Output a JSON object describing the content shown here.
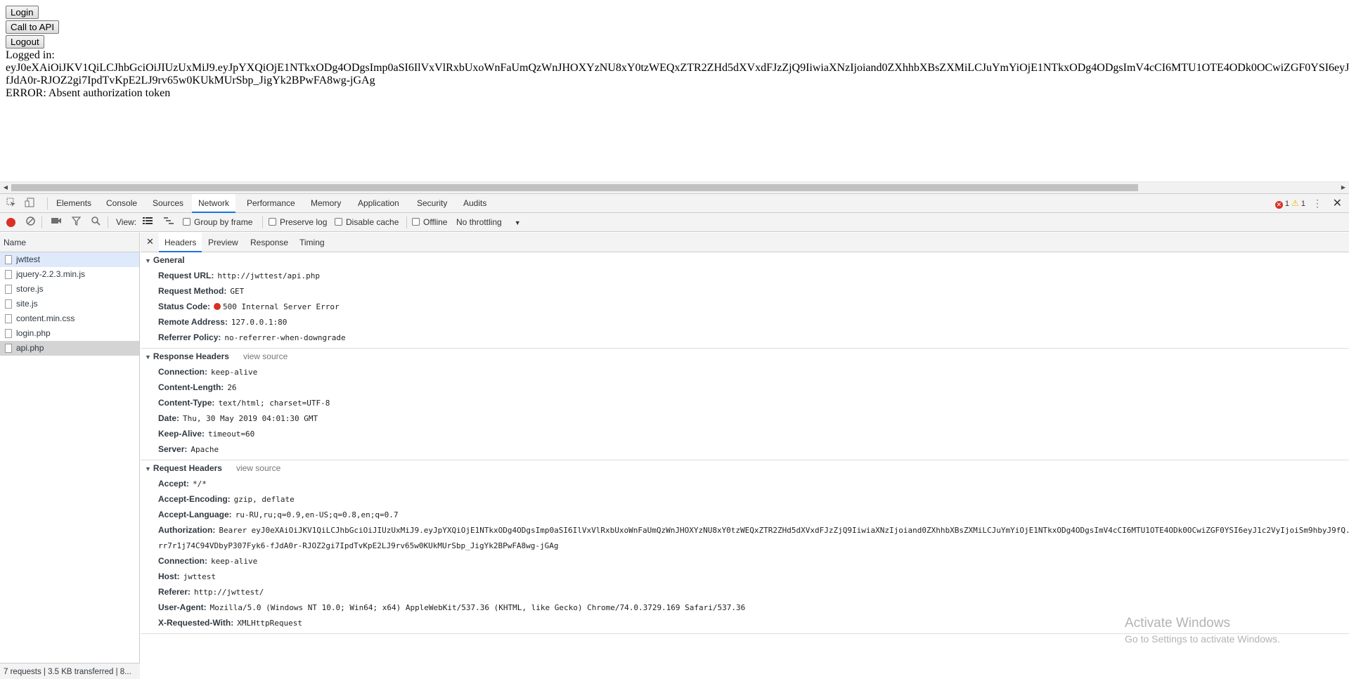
{
  "page": {
    "login_label": "Login",
    "call_api_label": "Call to API",
    "logout_label": "Logout",
    "logged_in_label": "Logged in:",
    "token_line1": "eyJ0eXAiOiJKV1QiLCJhbGciOiJIUzUxMiJ9.eyJpYXQiOjE1NTkxODg4ODgsImp0aSI6IlVxVlRxbUxoWnFaUmQzWnJHOXYzNU8xY0tzWEQxZTR2ZHd5dXVxdFJzZjQ9IiwiaXNzIjoiand0ZXhhbXBsZXMiLCJuYmYiOjE1NTkxODg4ODgsImV4cCI6MTU1OTE4ODk0OCwiZGF0YSI6eyJ",
    "token_line2": "fJdA0r-RJOZ2gi7IpdTvKpE2LJ9rv65w0KUkMUrSbp_JigYk2BPwFA8wg-jGAg",
    "error_text": "ERROR: Absent authorization token"
  },
  "devtools": {
    "tabs": [
      "Elements",
      "Console",
      "Sources",
      "Network",
      "Performance",
      "Memory",
      "Application",
      "Security",
      "Audits"
    ],
    "active_tab": "Network",
    "error_count": "1",
    "warning_count": "1",
    "toolbar": {
      "view_label": "View:",
      "group_by_frame": "Group by frame",
      "preserve_log": "Preserve log",
      "disable_cache": "Disable cache",
      "offline": "Offline",
      "throttling": "No throttling"
    },
    "requests": {
      "header": "Name",
      "items": [
        "jwttest",
        "jquery-2.2.3.min.js",
        "store.js",
        "site.js",
        "content.min.css",
        "login.php",
        "api.php"
      ],
      "selected": "api.php",
      "status": "7 requests  |  3.5 KB transferred  |  8..."
    },
    "detail_tabs": [
      "Headers",
      "Preview",
      "Response",
      "Timing"
    ],
    "general": {
      "title": "General",
      "request_url_k": "Request URL:",
      "request_url_v": "http://jwttest/api.php",
      "method_k": "Request Method:",
      "method_v": "GET",
      "status_k": "Status Code:",
      "status_v": "500 Internal Server Error",
      "remote_k": "Remote Address:",
      "remote_v": "127.0.0.1:80",
      "referrer_k": "Referrer Policy:",
      "referrer_v": "no-referrer-when-downgrade"
    },
    "response_headers": {
      "title": "Response Headers",
      "view_source": "view source",
      "connection_k": "Connection:",
      "connection_v": "keep-alive",
      "length_k": "Content-Length:",
      "length_v": "26",
      "type_k": "Content-Type:",
      "type_v": "text/html; charset=UTF-8",
      "date_k": "Date:",
      "date_v": "Thu, 30 May 2019 04:01:30 GMT",
      "keepalive_k": "Keep-Alive:",
      "keepalive_v": "timeout=60",
      "server_k": "Server:",
      "server_v": "Apache"
    },
    "request_headers": {
      "title": "Request Headers",
      "view_source": "view source",
      "accept_k": "Accept:",
      "accept_v": "*/*",
      "encoding_k": "Accept-Encoding:",
      "encoding_v": "gzip, deflate",
      "language_k": "Accept-Language:",
      "language_v": "ru-RU,ru;q=0.9,en-US;q=0.8,en;q=0.7",
      "auth_k": "Authorization:",
      "auth_v": "Bearer eyJ0eXAiOiJKV1QiLCJhbGciOiJIUzUxMiJ9.eyJpYXQiOjE1NTkxODg4ODgsImp0aSI6IlVxVlRxbUxoWnFaUmQzWnJHOXYzNU8xY0tzWEQxZTR2ZHd5dXVxdFJzZjQ9IiwiaXNzIjoiand0ZXhhbXBsZXMiLCJuYmYiOjE1NTkxODg4ODgsImV4cCI6MTU1OTE4ODk0OCwiZGF0YSI6eyJ1c2VyIjoiSm9hbyJ9fQ.",
      "auth_v2": "rr7r1j74C94VDbyP307Fyk6-fJdA0r-RJOZ2gi7IpdTvKpE2LJ9rv65w0KUkMUrSbp_JigYk2BPwFA8wg-jGAg",
      "connection_k": "Connection:",
      "connection_v": "keep-alive",
      "host_k": "Host:",
      "host_v": "jwttest",
      "referer_k": "Referer:",
      "referer_v": "http://jwttest/",
      "ua_k": "User-Agent:",
      "ua_v": "Mozilla/5.0 (Windows NT 10.0; Win64; x64) AppleWebKit/537.36 (KHTML, like Gecko) Chrome/74.0.3729.169 Safari/537.36",
      "xrw_k": "X-Requested-With:",
      "xrw_v": "XMLHttpRequest"
    }
  },
  "watermark": {
    "line1": "Activate Windows",
    "line2": "Go to Settings to activate Windows."
  }
}
